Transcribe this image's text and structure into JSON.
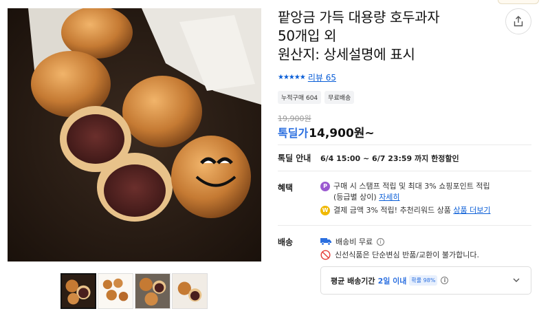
{
  "product": {
    "title_lines": [
      "팥앙금 가득 대용량 호두과자",
      "50개입 외",
      "원산지: 상세설명에 표시"
    ],
    "rating_stars": "★★★★★",
    "review_label": "리뷰 65",
    "badges": [
      "누적구매 604",
      "무료배송"
    ],
    "original_price": "19,900원",
    "deal_label": "톡딜가",
    "deal_price": "14,900원~"
  },
  "sale": {
    "label": "톡딜 안내",
    "text": "6/4 15:00 ~ 6/7 23:59 까지 한정할인"
  },
  "benefits": {
    "label": "혜택",
    "line1_icon": "P",
    "line1_text": "구매 시 스탬프 적립 및 최대 3% 쇼핑포인트 적립",
    "line1_text2": "(등급별 상이)",
    "line1_link": "자세히",
    "line2_icon": "W",
    "line2_text": "결제 금액 3% 적립! 추천리워드 상품",
    "line2_link": "상품 더보기"
  },
  "shipping": {
    "label": "배송",
    "fee_text": "배송비 무료",
    "notice": "신선식품은 단순변심 반품/교환이 불가합니다.",
    "avg_label": "평균 배송기간",
    "avg_value": "2일 이내",
    "prob_badge": "확률 98%"
  },
  "icons": {
    "share": "share-icon",
    "truck": "truck-icon",
    "no": "no-entry-icon",
    "chevron": "chevron-down-icon"
  },
  "colors": {
    "accent_blue": "#2b6fe0",
    "link_blue": "#0a5ed7",
    "point_purple": "#9b59d0",
    "reward_yellow": "#f0b800",
    "no_red": "#e53935"
  }
}
